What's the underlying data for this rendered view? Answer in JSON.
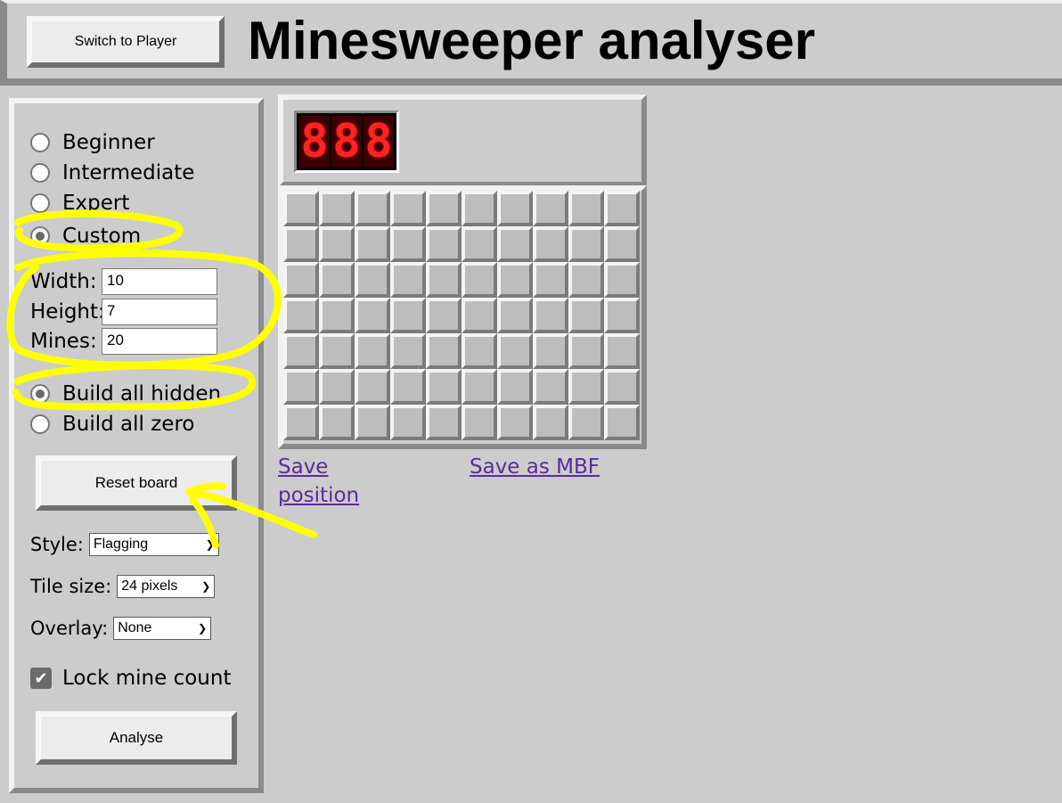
{
  "header": {
    "switch_button": "Switch to Player",
    "title": "Minesweeper analyser"
  },
  "sidebar": {
    "difficulty_options": [
      {
        "label": "Beginner",
        "checked": false
      },
      {
        "label": "Intermediate",
        "checked": false
      },
      {
        "label": "Expert",
        "checked": false
      },
      {
        "label": "Custom",
        "checked": true
      }
    ],
    "width_label": "Width:",
    "width_value": "10",
    "height_label": "Height:",
    "height_value": "7",
    "mines_label": "Mines:",
    "mines_value": "20",
    "build_options": [
      {
        "label": "Build all hidden",
        "checked": true
      },
      {
        "label": "Build all zero",
        "checked": false
      }
    ],
    "reset_button": "Reset board",
    "style_label": "Style:",
    "style_value": "Flagging",
    "tile_size_label": "Tile size:",
    "tile_size_value": "24 pixels",
    "overlay_label": "Overlay:",
    "overlay_value": "None",
    "lock_label": "Lock mine count",
    "lock_checked": true,
    "analyse_button": "Analyse"
  },
  "board": {
    "mine_counter": "888",
    "columns": 10,
    "rows": 7,
    "save_position_link": "Save position",
    "save_mbf_link": "Save as MBF"
  },
  "colors": {
    "background": "#cccccc",
    "link": "#5a2b9c",
    "annotation": "#ffff00",
    "counter_digit": "#ff2222"
  }
}
